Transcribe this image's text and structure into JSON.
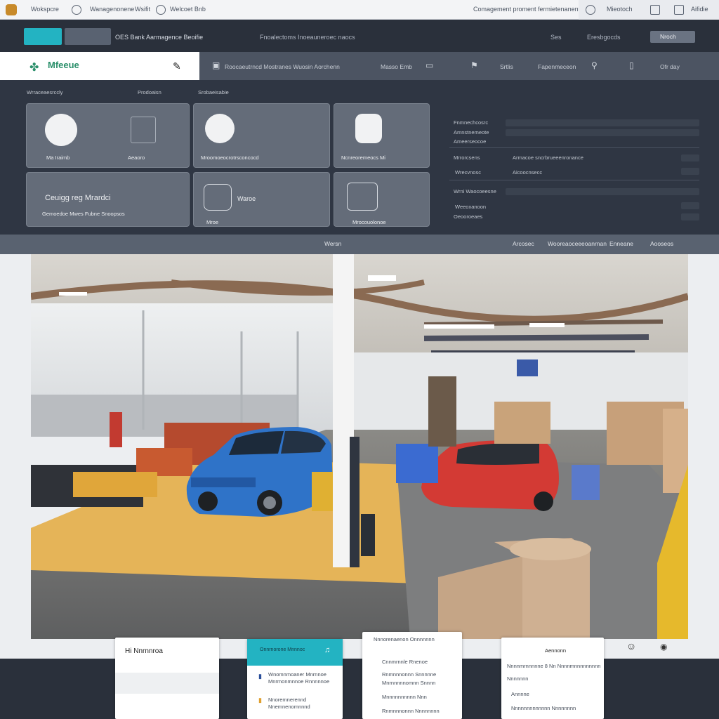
{
  "topbar": {
    "item1": "Wokspcre",
    "item2": "Wanagenonene",
    "item3": "Wsifit",
    "item4": "Welcoet Bnb",
    "right_text": "Comagement proment fermietenanent",
    "right_item1": "Mieotoch",
    "right_item2": "Aifidie"
  },
  "toolbar": {
    "teal_label": "",
    "gray_label": "",
    "title": "OES Bank Aarmagence Beoifie",
    "center_text": "Fnoalectoms Inoeauneroec naocs",
    "right1": "Ses",
    "right2": "Eresbgocds",
    "right_button": "Nroch"
  },
  "nav": {
    "brand": "Mfeeue",
    "search_text": "Roocaeutrncd Mostranes Wuosin Aorchenn",
    "item1": "Masso Emb",
    "item2": "Srtlis",
    "item3": "Fapenmeceon",
    "item4": "Wrla",
    "item5": "Ofr day"
  },
  "dashboard": {
    "left_title": "Wrraceaesrccly",
    "left_title2": "Prodoaisn",
    "mid_title": "Srobaeisabie",
    "cards": {
      "c1_label": "Ma Iraimb",
      "c1b_label": "Aeaoro",
      "c2_label": "Mroomoeocrotrsconcocd",
      "c3_label": "Ncnreoremeocs Mi",
      "c4_title": "Ceuigg reg Mrardci",
      "c4_sub": "Gemoedoe Mwes Fubne Snoopsos",
      "c5_title": "Waroe",
      "c5_sub": "Mroe",
      "c6_sub": "Mrocouolonoe"
    },
    "right": {
      "r1": "Fnmnechcosrc",
      "r2": "Amnstnemeote",
      "r3": "Ameerseocoe",
      "r4": "Mrrorcsens",
      "r4b": "Armacoe sncrbrueeenronance",
      "r5": "Wrecvnosc",
      "r5b": "Aicoocnsecc",
      "r6": "Wrni Waocoeesne",
      "r7": "Weeoxanoon",
      "r8": "Oeooroeaes"
    }
  },
  "strip": {
    "center": "Wersn",
    "item1": "Arcosec",
    "item2": "Wooreaoceeeoanrnan",
    "item3": "Enneane",
    "item4": "Aooseos"
  },
  "bottom": {
    "card1_title": "Hi Nnrnnroa",
    "card2_title": "Onnrnorone Mnnnoc",
    "card2_line1": "Wnomnmoaner Mnrnnoe",
    "card2_line2": "Mnrmonmnnoe Rnnnnnoe",
    "card2_line3": "Nnoremnerennd",
    "card2_line4": "Nnemnenomnnnd",
    "card3_title": "Nnnorenaenon Onnnnnnn",
    "card3_line1": "Cnnmrnnle Rnenoe",
    "card3_line2": "Rnmnnnonnn Snnnnne",
    "card3_line3": "Mnrnnnnnomnn Snnnn",
    "card3_line4": "Mnnnnnnnnnn Nnn",
    "card3_line5": "Rnmnnnonnn Nnnnnnnn",
    "card4_title": "Aennonn",
    "card4_line1": "Nnnnmrnnnnne 8 Nn Nnnnmnnnnnnnnn",
    "card4_line2": "Nnnnnnn",
    "card4_line3": "Annnne",
    "card4_line4": "Nnnnnnnnnnnnn Nnnnnnnn"
  },
  "colors": {
    "accent": "#23b3c2",
    "brand": "#2a8f6a",
    "dark": "#2a303b"
  }
}
